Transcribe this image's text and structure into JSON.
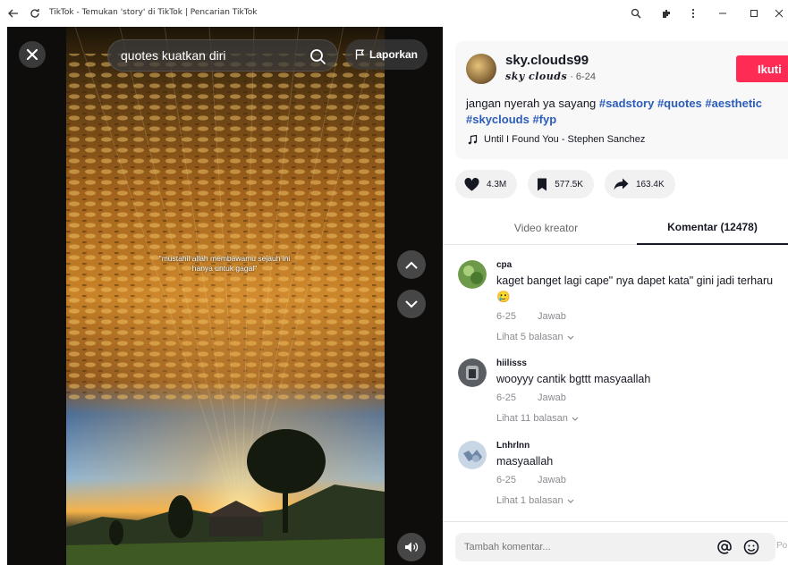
{
  "window": {
    "title": "TikTok - Temukan 'story' di TikTok | Pencarian TikTok"
  },
  "player": {
    "search_value": "quotes kuatkan diri",
    "report_label": "Laporkan",
    "caption_line1": "\"mustahil allah membawamu sejauh ini",
    "caption_line2": "hanya untuk gagal\""
  },
  "post": {
    "username": "sky.clouds99",
    "nickname": "sky clouds",
    "date": " · 6-24",
    "follow_label": "Ikuti",
    "desc_text": "jangan nyerah ya sayang ",
    "hashtags": [
      "#sadstory",
      "#quotes",
      "#aesthetic",
      "#skyclouds",
      "#fyp"
    ],
    "music": "Until I Found You - Stephen Sanchez",
    "likes": "4.3M",
    "saves": "577.5K",
    "shares": "163.4K"
  },
  "tabs": {
    "video": "Video kreator",
    "comments": "Komentar (12478)"
  },
  "comments": [
    {
      "user": "cpa",
      "text": "kaget banget lagi cape\" nya dapet kata\" gini jadi terharu 🥲",
      "date": "6-25",
      "reply": "Jawab",
      "replies": "Lihat 5 balasan"
    },
    {
      "user": "hiilisss",
      "text": "wooyyy cantik bgttt masyaallah",
      "date": "6-25",
      "reply": "Jawab",
      "replies": "Lihat 11 balasan"
    },
    {
      "user": "Lnhrlnn",
      "text": "masyaallah",
      "date": "6-25",
      "reply": "Jawab",
      "replies": "Lihat 1 balasan"
    }
  ],
  "composer": {
    "placeholder": "Tambah komentar...",
    "post_label": "Po"
  },
  "colors": {
    "accent": "#fe2c55",
    "hashtag": "#2b5db9",
    "text": "#161823",
    "muted": "#8a8b91"
  }
}
